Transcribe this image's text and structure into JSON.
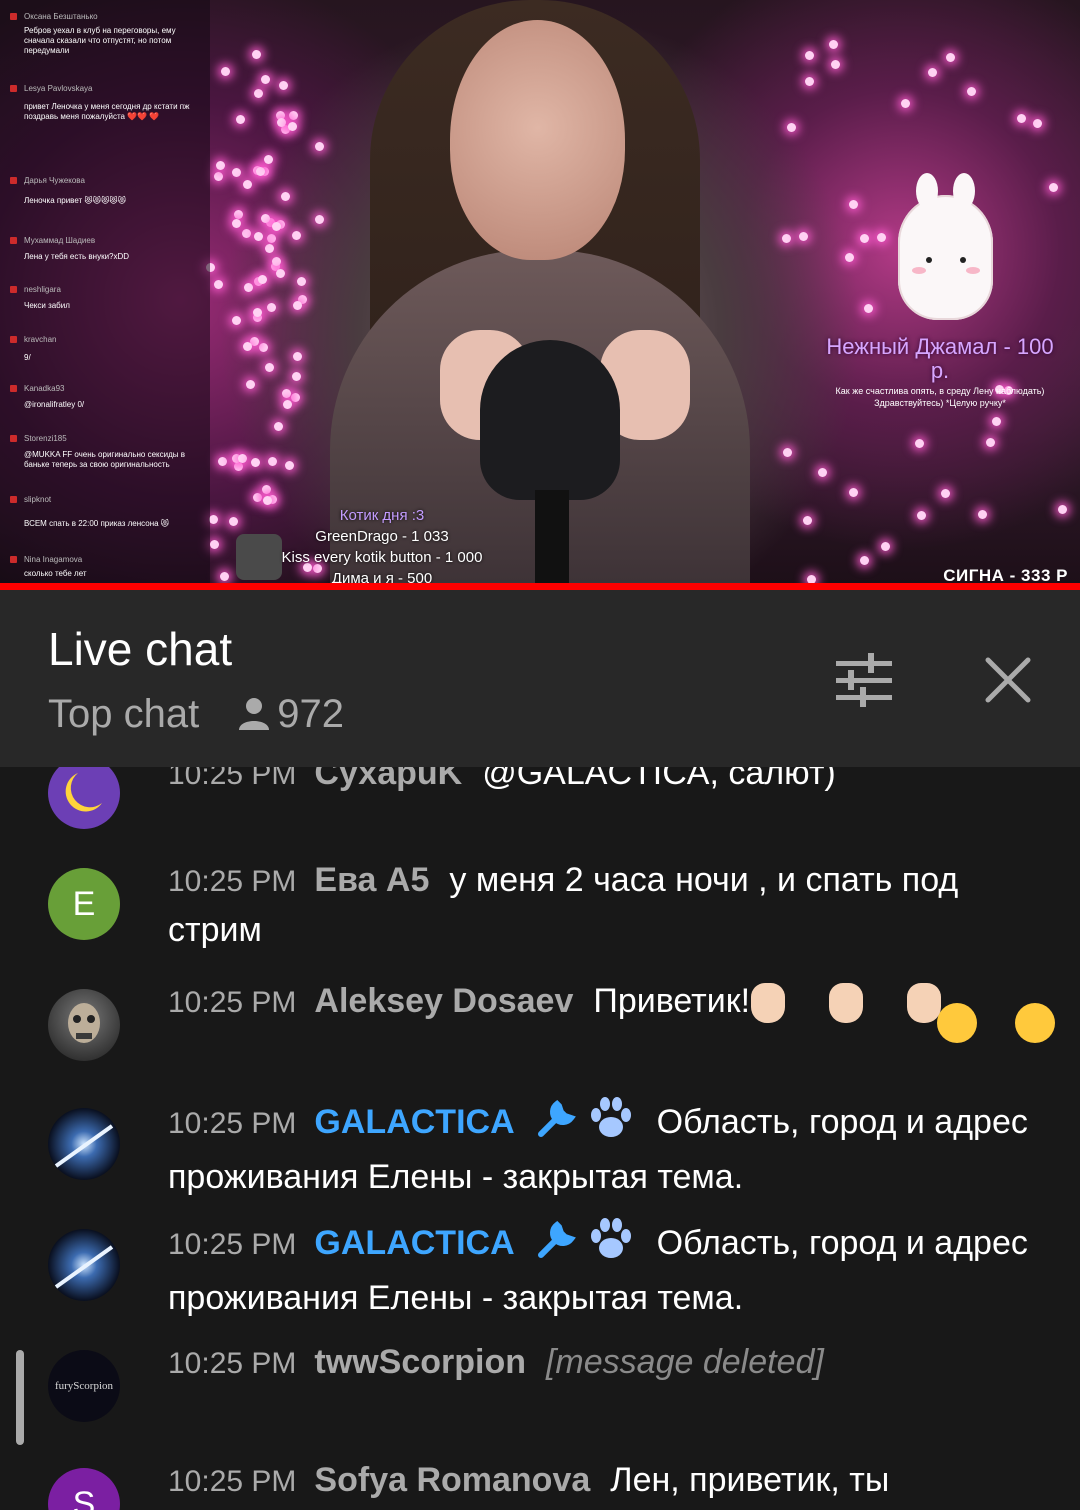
{
  "video": {
    "overlay_chat": [
      {
        "name": "Оксана Безштанько",
        "text": "Ребров уехал в клуб на переговоры, ему сначала сказали что отпустят, но потом передумали"
      },
      {
        "name": "Lesya Pavlovskaya",
        "text": "привет Леночка у меня сегодня др кстати пж поздравь меня пожалуйста ❤️❤️ ❤️"
      },
      {
        "name": "Дарья Чужекова",
        "text": "Леночка привет 😻😻😻😻😻"
      },
      {
        "name": "Мухаммад Шадиев",
        "text": "Лена у тебя есть внуки?xDD"
      },
      {
        "name": "neshligara",
        "text": "Чекси забил"
      },
      {
        "name": "kravchan",
        "text": "9/"
      },
      {
        "name": "Kanadka93",
        "text": "@ironalifratley 0/"
      },
      {
        "name": "Storenzi185",
        "text": "@MUKKA FF очень оригинально сексиды в баньке теперь за свою оригинальность"
      },
      {
        "name": "slipknot",
        "text": "ВСЕМ спать в 22:00 приказ ленсона 😻"
      },
      {
        "name": "Nina Inagamova",
        "text": "сколько тебе лет"
      }
    ],
    "donation": {
      "title": "Нежный Джамал - 100 р.",
      "text": "Как же счастлива опять, в среду Лену наблюдать) Здравствуйтесь) *Целую ручку*"
    },
    "goals": [
      "Котик дня :3",
      "GreenDrago - 1 033",
      "Kiss every kotik button - 1 000",
      "Дима и я - 500"
    ],
    "corner_text": "СИГНА - 333 Р"
  },
  "header": {
    "title": "Live chat",
    "mode": "Top chat",
    "viewers": "972"
  },
  "icons": {
    "viewer": "person-icon",
    "filter": "sliders-icon",
    "close": "close-icon"
  },
  "messages": [
    {
      "time": "10:25 PM",
      "author": "СухаpuK",
      "text": "@GALACTICA, салют)",
      "avatar_color": "#6c3fb5",
      "avatar_letter": ""
    },
    {
      "time": "10:25 PM",
      "author": "Ева А5",
      "text": "у меня 2 часа ночи , и спать под стрим",
      "avatar_color": "#689f38",
      "avatar_letter": "E"
    },
    {
      "time": "10:25 PM",
      "author": "Aleksey Dosaev",
      "text": "Приветик!",
      "avatar_color": "#2b2b2b",
      "avatar_letter": ""
    },
    {
      "time": "10:25 PM",
      "author": "GALACTICA",
      "text": "Область, город и адрес проживания Елены - закрытая тема.",
      "avatar_color": "#1b2740",
      "avatar_letter": ""
    },
    {
      "time": "10:25 PM",
      "author": "GALACTICA",
      "text": "Область, город и адрес проживания Елены - закрытая тема.",
      "avatar_color": "#1b2740",
      "avatar_letter": ""
    },
    {
      "time": "10:25 PM",
      "author": "twwScorpion",
      "text": "[message deleted]",
      "avatar_color": "#0b0b16",
      "avatar_letter": "furyScorpion"
    },
    {
      "time": "10:25 PM",
      "author": "Sofya Romanova",
      "text": "Лен, приветик, ты",
      "avatar_color": "#7b1fa2",
      "avatar_letter": "S"
    }
  ],
  "colors": {
    "moderator": "#3ea6ff",
    "progress": "#ff0000",
    "header_bg": "#282828",
    "chat_bg": "#181818"
  }
}
